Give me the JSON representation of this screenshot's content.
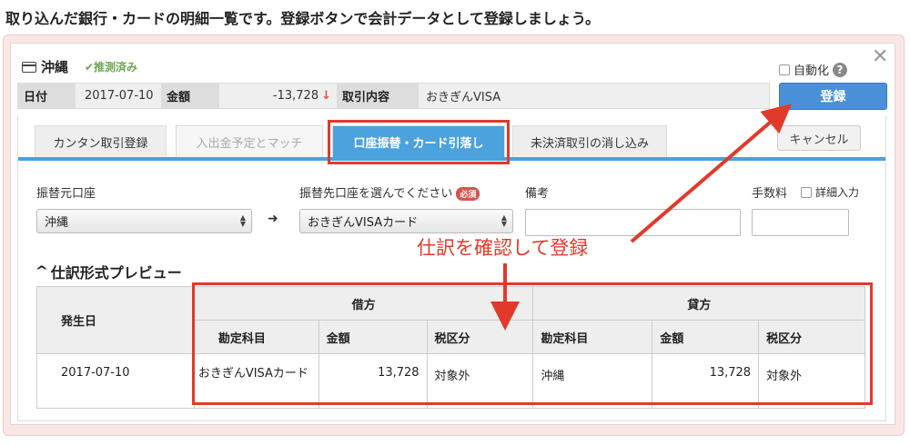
{
  "heading": "取り込んだ銀行・カードの明細一覧です。登録ボタンで会計データとして登録しましょう。",
  "account": {
    "icon": "credit-card-icon",
    "name": "沖縄",
    "status": "✔推測済み"
  },
  "auto": {
    "label": "自動化",
    "checked": false,
    "help": "?"
  },
  "transaction": {
    "date_label": "日付",
    "date": "2017-07-10",
    "amount_label": "金額",
    "amount": "-13,728",
    "desc_label": "取引内容",
    "desc": "おきぎんVISA"
  },
  "actions": {
    "register": "登録",
    "cancel": "キャンセル"
  },
  "tabs": [
    {
      "label": "カンタン取引登録",
      "state": "normal"
    },
    {
      "label": "入出金予定とマッチ",
      "state": "disabled"
    },
    {
      "label": "口座振替・カード引落し",
      "state": "active"
    },
    {
      "label": "未決済取引の消し込み",
      "state": "normal"
    }
  ],
  "form": {
    "source_label": "振替元口座",
    "source_value": "沖縄",
    "dest_label": "振替先口座を選んでください",
    "required": "必須",
    "dest_value": "おきぎんVISAカード",
    "memo_label": "備考",
    "fee_label": "手数料",
    "detail_label": "詳細入力"
  },
  "annotation": "仕訳を確認して登録",
  "preview": {
    "title": "仕訳形式プレビュー",
    "headers": {
      "date": "発生日",
      "debit": "借方",
      "credit": "貸方",
      "account": "勘定科目",
      "amount": "金額",
      "tax": "税区分"
    },
    "row": {
      "date": "2017-07-10",
      "debit_account": "おきぎんVISAカード",
      "debit_amount": "13,728",
      "debit_tax": "対象外",
      "credit_account": "沖縄",
      "credit_amount": "13,728",
      "credit_tax": "対象外"
    }
  },
  "colors": {
    "accent": "#4ba2dc",
    "annotation": "#e13a2a",
    "inferred": "#6aa84f"
  }
}
